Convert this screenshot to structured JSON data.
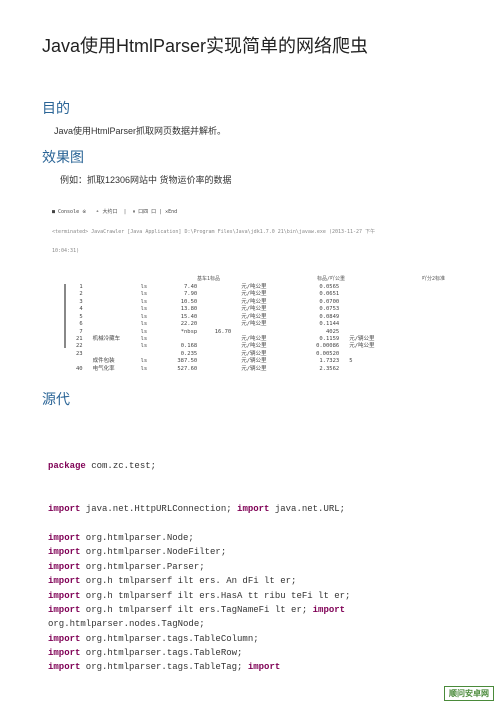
{
  "title": "Java使用HtmlParser实现简单的网络爬虫",
  "sections": {
    "purpose_h": "目的",
    "purpose_body": "Java使用HtmlParser抓取网页数据并解析。",
    "effect_h": "效果图",
    "effect_body": "例如：抓取12306网站中  货物运价率的数据",
    "source_h": "源代"
  },
  "console": {
    "header": "■ Console ※   ⚬ 大约口  |  ⏸ 口四 口 | ✕End",
    "term": "<terminated> JavaCrawler [Java Application] D:\\Program Files\\Java\\jdk1.7.0 21\\bin\\javaw.exe (2013-11-27 下午",
    "timestamp": "10:04:31)"
  },
  "tableHeaders": {
    "h1": "基车1标品",
    "h2": "标品/吖公重",
    "h3": "吖分2标准"
  },
  "tableData": {
    "col_idx": [
      "1",
      "2",
      "3",
      "4",
      "5",
      "6",
      "7",
      "21",
      "22",
      "23",
      "",
      "40"
    ],
    "col_label": [
      "",
      "",
      "",
      "",
      "",
      "",
      "",
      "机械冷藏车",
      "",
      "",
      "成件包装",
      "电气化率"
    ],
    "col_ls": [
      "ls",
      "ls",
      "ls",
      "ls",
      "ls",
      "ls",
      "ls",
      "ls",
      "ls",
      "",
      "ls",
      "ls"
    ],
    "col_v1": [
      "7.40",
      "7.90",
      "10.50",
      "13.80",
      "15.40",
      "22.20",
      "*nbsp",
      "",
      "0.168",
      "0.235",
      "387.50",
      "527.60"
    ],
    "col_v1b": [
      "",
      "",
      "",
      "",
      "",
      "",
      "16.70",
      "",
      "",
      "",
      "",
      ""
    ],
    "col_lbl2": [
      "元/吨公里",
      "元/吨公里",
      "元/吨公里",
      "元/吨公里",
      "元/吨公里",
      "元/吨公里",
      "",
      "元/吨公里",
      "元/吨公里",
      "元/辆公里",
      "元/辆公里",
      "元/辆公里"
    ],
    "col_v2": [
      "0.0565",
      "0.0651",
      "0.0700",
      "0.0753",
      "0.0849",
      "0.1144",
      "4025",
      "0.1159",
      "0.00086",
      "0.00520",
      "1.7323",
      "2.3562"
    ],
    "col_lbl3": [
      "",
      "",
      "",
      "",
      "",
      "",
      "",
      "元/辆公里",
      "元/吨公里",
      "",
      "5",
      ""
    ],
    "right_labels": [
      "标品/吖公重",
      "吖分2标准"
    ]
  },
  "code": {
    "lines": [
      {
        "pre": "",
        "kw": "package",
        "rest": " com.zc.test;"
      },
      {
        "pre": "",
        "kw": "",
        "rest": ""
      },
      {
        "pre": "",
        "kw": "",
        "rest": ""
      },
      {
        "pre": "",
        "kw": "import",
        "rest": " java.net.HttpURLConnection; ",
        "kw2": "import",
        "rest2": " java.net.URL;"
      },
      {
        "pre": "",
        "kw": "",
        "rest": ""
      },
      {
        "pre": "",
        "kw": "import",
        "rest": " org.htmlparser.Node;"
      },
      {
        "pre": "",
        "kw": "import",
        "rest": " org.htmlparser.NodeFilter;"
      },
      {
        "pre": "",
        "kw": "import",
        "rest": " org.htmlparser.Parser;"
      },
      {
        "pre": "",
        "kw": "import",
        "rest": " org.h tmlparserf ilt ers. An dFi lt er;"
      },
      {
        "pre": "",
        "kw": "import",
        "rest": " org.h tmlparserf ilt ers.HasA tt ribu teFi lt er;"
      },
      {
        "pre": "",
        "kw": "import",
        "rest": " org.h tmlparserf ilt ers.TagNameFi lt er; ",
        "kw2": "import",
        "rest2": ""
      },
      {
        "pre": "",
        "kw": "",
        "rest": "org.htmlparser.nodes.TagNode;"
      },
      {
        "pre": "",
        "kw": "import",
        "rest": " org.htmlparser.tags.TableColumn;"
      },
      {
        "pre": "",
        "kw": "import",
        "rest": " org.htmlparser.tags.TableRow;"
      },
      {
        "pre": "",
        "kw": "import",
        "rest": " org.htmlparser.tags.TableTag; ",
        "kw2": "import",
        "rest2": ""
      }
    ]
  },
  "watermark": "顺问安卓网"
}
